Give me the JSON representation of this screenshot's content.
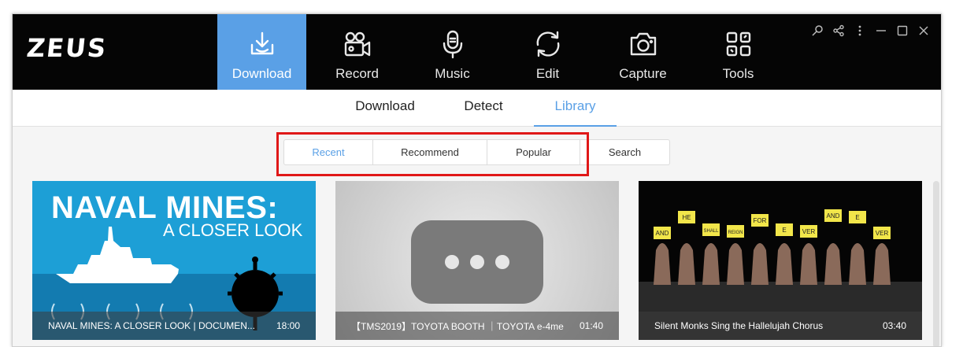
{
  "app": {
    "logo": "ZEUS"
  },
  "nav": [
    {
      "label": "Download",
      "icon": "download-icon",
      "active": true
    },
    {
      "label": "Record",
      "icon": "video-camera-icon",
      "active": false
    },
    {
      "label": "Music",
      "icon": "microphone-icon",
      "active": false
    },
    {
      "label": "Edit",
      "icon": "refresh-icon",
      "active": false
    },
    {
      "label": "Capture",
      "icon": "camera-icon",
      "active": false
    },
    {
      "label": "Tools",
      "icon": "tools-grid-icon",
      "active": false
    }
  ],
  "subtabs": [
    {
      "label": "Download",
      "active": false
    },
    {
      "label": "Detect",
      "active": false
    },
    {
      "label": "Library",
      "active": true
    }
  ],
  "filters": [
    {
      "label": "Recent",
      "active": true
    },
    {
      "label": "Recommend",
      "active": false
    },
    {
      "label": "Popular",
      "active": false
    },
    {
      "label": "Search",
      "active": false
    }
  ],
  "videos": [
    {
      "title": "NAVAL MINES: A CLOSER LOOK | DOCUMEN...",
      "duration": "18:00",
      "thumb_heading": "NAVAL MINES:",
      "thumb_subheading": "A CLOSER LOOK"
    },
    {
      "title": "【TMS2019】TOYOTA BOOTH ｜TOYOTA e-4me",
      "duration": "01:40"
    },
    {
      "title": "Silent Monks Sing the Hallelujah Chorus",
      "duration": "03:40",
      "signs": [
        "AND",
        "HE",
        "SHALL",
        "REIGN",
        "FOR",
        "E",
        "VER",
        "AND",
        "E",
        "VER"
      ]
    }
  ],
  "colors": {
    "accent": "#5aa0e6",
    "topbar": "#050505",
    "highlight": "#e01818",
    "naval_bg": "#1d9fd6"
  }
}
